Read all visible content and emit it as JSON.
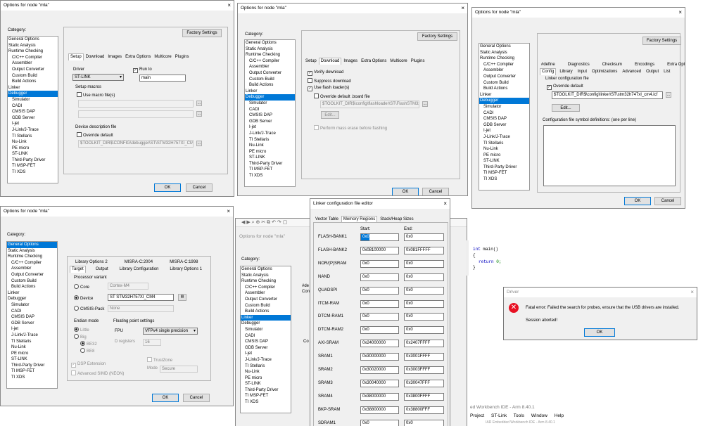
{
  "dialog_title": "Options for node \"mla\"",
  "close_glyph": "×",
  "category_label": "Category:",
  "factory_settings": "Factory Settings",
  "ok": "OK",
  "cancel": "Cancel",
  "ellipsis": "...",
  "edit": "Edit...",
  "category_tree": [
    "General Options",
    "Static Analysis",
    "Runtime Checking",
    "C/C++ Compiler",
    "Assembler",
    "Output Converter",
    "Custom Build",
    "Build Actions",
    "Linker",
    "Debugger",
    "Simulator",
    "CADI",
    "CMSIS DAP",
    "GDB Server",
    "I-jet",
    "J-Link/J-Trace",
    "TI Stellaris",
    "Nu-Link",
    "PE micro",
    "ST-LINK",
    "Third-Party Driver",
    "TI MSP-FET",
    "TI XDS"
  ],
  "d1": {
    "tabs": [
      "Setup",
      "Download",
      "Images",
      "Extra Options",
      "Multicore",
      "Plugins"
    ],
    "driver_label": "Driver",
    "driver_value": "ST-LINK",
    "run_to_label": "Run to",
    "run_to_value": "main",
    "setup_macros": "Setup macros",
    "use_macro_files": "Use macro file(s)",
    "device_desc": "Device description file",
    "override_default": "Override default",
    "ddf_path": "$TOOLKIT_DIR$\\CONFIG\\debugger\\ST\\STM32H757XI_CM4.d"
  },
  "d2": {
    "tabs": [
      "Setup",
      "Download",
      "Images",
      "Extra Options",
      "Multicore",
      "Plugins"
    ],
    "verify": "Verify download",
    "suppress": "Suppress download",
    "use_flash": "Use flash loader(s)",
    "override_board": "Override default .board file",
    "board_path": "$TOOLKIT_DIR$\\config\\flashloader\\ST\\FlashSTM32H",
    "mass_erase": "Perform mass erase before flashing"
  },
  "d3": {
    "tabs_top": [
      "#define",
      "Diagnostics",
      "Checksum",
      "Encodings",
      "Extra Options"
    ],
    "tabs_bottom": [
      "Config",
      "Library",
      "Input",
      "Optimizations",
      "Advanced",
      "Output",
      "List"
    ],
    "linker_cfg": "Linker configuration file",
    "override_default": "Override default",
    "icf_path": "$TOOLKIT_DIR$\\config\\linker\\ST\\stm32h747xI_cm4.icf",
    "symbol_defs": "Configuration file symbol definitions: (one per line)"
  },
  "d4": {
    "tabs_top": [
      "Library Options 2",
      "MISRA-C:2004",
      "MISRA-C:1998"
    ],
    "tabs_bottom": [
      "Target",
      "Output",
      "Library Configuration",
      "Library Options 1"
    ],
    "processor_variant": "Processor variant",
    "core": "Core",
    "core_value": "Cortex-M4",
    "device": "Device",
    "device_value": "ST STM32H757XI_CM4",
    "cmsis_pack": "CMSIS-Pack",
    "cmsis_value": "None",
    "endian_mode": "Endian mode",
    "little": "Little",
    "big": "Big",
    "be32": "BE32",
    "be8": "BE8",
    "fp_settings": "Floating point settings",
    "fpu": "FPU",
    "fpu_value": "VFPv4 single precision",
    "d_registers": "D registers",
    "d_reg_value": "16",
    "dsp": "DSP Extension",
    "simd": "Advanced SIMD (NEON)",
    "trustzone": "TrustZone",
    "mode": "Mode",
    "mode_value": "Secure"
  },
  "d5": {
    "title": "Options for node \"mla\"",
    "frag_define": "#de",
    "frag_con": "Con",
    "frag_co": "Co"
  },
  "lcfe": {
    "title": "Linker configuration file editor",
    "tabs": [
      "Vector Table",
      "Memory Regions",
      "Stack/Heap Sizes"
    ],
    "start": "Start:",
    "end": "End:",
    "rows": [
      {
        "name": "FLASH-BANK1",
        "start": "0x0",
        "end": "0x0"
      },
      {
        "name": "FLASH-BANK2",
        "start": "0x08100000",
        "end": "0x081FFFFF"
      },
      {
        "name": "NOR/(P)SRAM",
        "start": "0x0",
        "end": "0x0"
      },
      {
        "name": "NAND",
        "start": "0x0",
        "end": "0x0"
      },
      {
        "name": "QUADSPI",
        "start": "0x0",
        "end": "0x0"
      },
      {
        "name": "ITCM-RAM",
        "start": "0x0",
        "end": "0x0"
      },
      {
        "name": "DTCM-RAM1",
        "start": "0x0",
        "end": "0x0"
      },
      {
        "name": "DTCM-RAM2",
        "start": "0x0",
        "end": "0x0"
      },
      {
        "name": "AXI-SRAM",
        "start": "0x24000000",
        "end": "0x2407FFFF"
      },
      {
        "name": "SRAM1",
        "start": "0x30000000",
        "end": "0x3001FFFF"
      },
      {
        "name": "SRAM2",
        "start": "0x30020000",
        "end": "0x3003FFFF"
      },
      {
        "name": "SRAM3",
        "start": "0x30040000",
        "end": "0x30047FFF"
      },
      {
        "name": "SRAM4",
        "start": "0x38000000",
        "end": "0x3800FFFF"
      },
      {
        "name": "BKP-SRAM",
        "start": "0x38800000",
        "end": "0x38800FFF"
      },
      {
        "name": "SDRAM1",
        "start": "0x0",
        "end": "0x0"
      }
    ]
  },
  "code": {
    "line1": "int main()",
    "line2": "{",
    "line3": "return 0;",
    "line4": "}"
  },
  "driver_dialog": {
    "title": "Driver",
    "message": "Fatal error: Failed the search for probes, ensure that the USB drivers are installed.",
    "sub": "Session aborted!",
    "ok": "OK"
  },
  "ide": {
    "title_frag": "ed Workbench IDE - Arm 8.40.1",
    "menu": [
      "Project",
      "ST-Link",
      "Tools",
      "Window",
      "Help"
    ],
    "bottom_frag": "IAR Embedded Workbench IDE - Arm 8.40.1"
  },
  "colors": {
    "selection": "#0078d7",
    "error": "#e81123"
  }
}
